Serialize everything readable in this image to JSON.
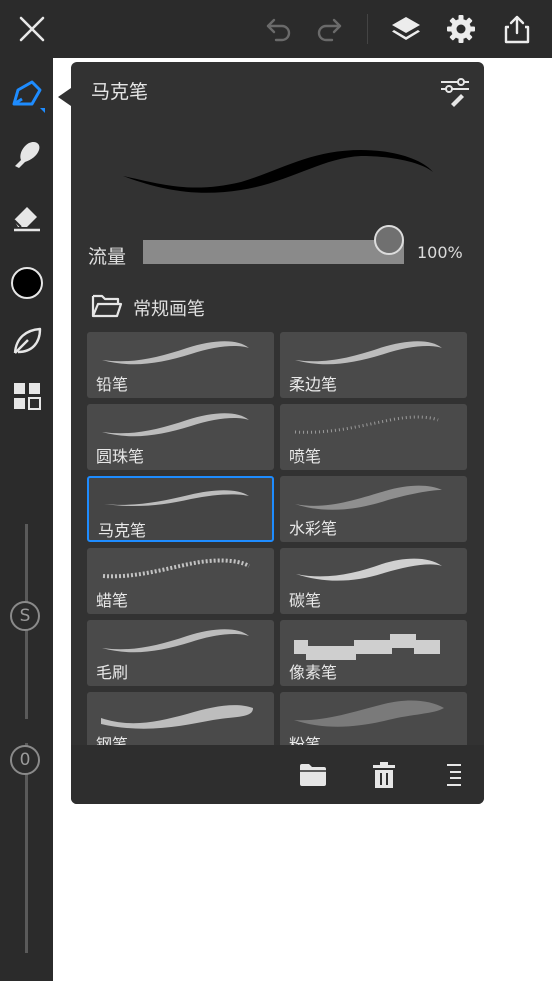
{
  "colors": {
    "bar_bg": "#2b2b2b",
    "panel_bg": "#323232",
    "tile_bg": "#4a4a4a",
    "selected_border": "#1e8cff",
    "active_tool": "#1e8cff",
    "current_color": "#000000"
  },
  "toolbar": {
    "icons": [
      "close-icon",
      "undo-icon",
      "redo-icon",
      "layers-icon",
      "gear-icon",
      "share-icon"
    ]
  },
  "sidebar": {
    "tools": [
      "brush-tool-icon",
      "smudge-tool-icon",
      "eraser-tool-icon",
      "color-swatch",
      "leaf-tool-icon",
      "grid-tool-icon"
    ],
    "size_slider_label": "S",
    "opacity_slider_label": "0"
  },
  "brush_panel": {
    "title": "马克笔",
    "flow_label": "流量",
    "flow_value": "100%",
    "flow_fraction": 1.0,
    "folder_name": "常规画笔",
    "brushes": [
      {
        "label": "铅笔",
        "style": "soft",
        "selected": false
      },
      {
        "label": "柔边笔",
        "style": "soft",
        "selected": false
      },
      {
        "label": "圆珠笔",
        "style": "soft",
        "selected": false
      },
      {
        "label": "喷笔",
        "style": "spray",
        "selected": false
      },
      {
        "label": "马克笔",
        "style": "thin",
        "selected": true
      },
      {
        "label": "水彩笔",
        "style": "watercolor",
        "selected": false
      },
      {
        "label": "蜡笔",
        "style": "crayon",
        "selected": false
      },
      {
        "label": "碳笔",
        "style": "charcoal",
        "selected": false
      },
      {
        "label": "毛刷",
        "style": "soft",
        "selected": false
      },
      {
        "label": "像素笔",
        "style": "pixel",
        "selected": false
      },
      {
        "label": "钢笔",
        "style": "thick",
        "selected": false
      },
      {
        "label": "粉笔",
        "style": "chalk",
        "selected": false
      }
    ],
    "bottom_icons": [
      "folder-icon",
      "trash-icon",
      "menu-icon"
    ]
  }
}
